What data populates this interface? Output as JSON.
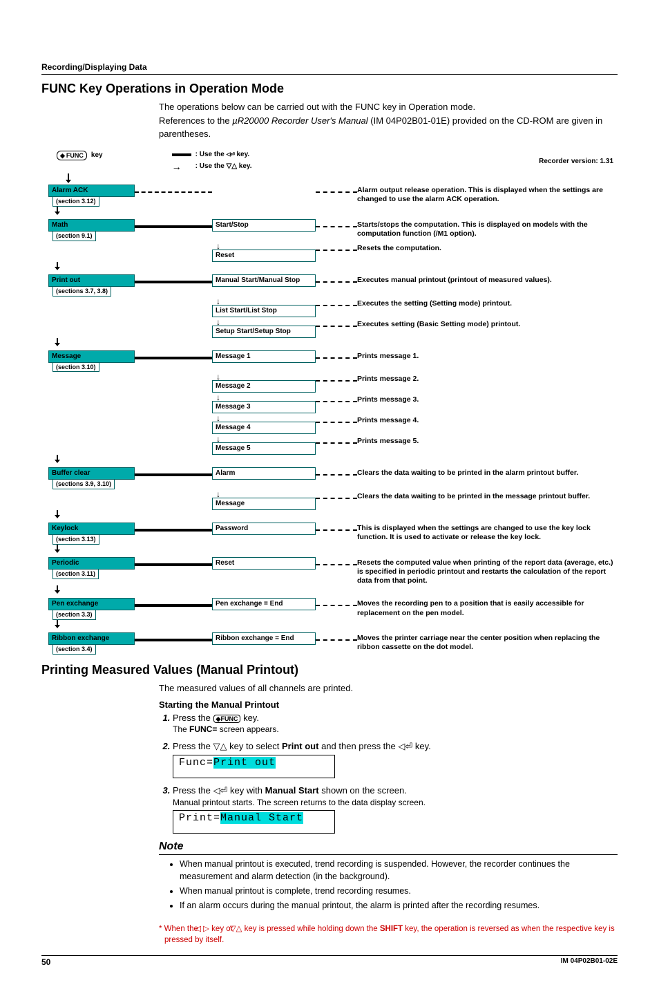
{
  "page": {
    "section_header": "Recording/Displaying Data",
    "h1": "FUNC Key Operations in Operation Mode",
    "intro1": "The operations below can be carried out with the FUNC key in Operation mode.",
    "intro2a": "References to the ",
    "intro2b": "µR20000 Recorder User's Manual",
    "intro2c": " (IM 04P02B01-01E) provided on the CD-ROM are given in parentheses.",
    "func_key": "FUNC",
    "key_label": "key",
    "legend_enter": ": Use the       key.",
    "legend_updown": ": Use the       key.",
    "version": "Recorder version: 1.31",
    "h2": "Printing Measured Values (Manual Printout)",
    "p2": "The measured values of all channels are printed.",
    "h3": "Starting the Manual Printout",
    "step1a": "Press the ",
    "step1b": " key.",
    "step1_sub_a": "The ",
    "step1_sub_b": "FUNC=",
    "step1_sub_c": " screen appears.",
    "step2a": "Press the ",
    "step2b": " key to select ",
    "step2c": "Print out",
    "step2d": " and then press the ",
    "step2e": " key.",
    "screen1_a": "Func=",
    "screen1_b": "Print out",
    "step3a": "Press the ",
    "step3b": " key with ",
    "step3c": "Manual Start",
    "step3d": " shown on the screen.",
    "step3_sub": "Manual printout starts. The screen returns to the data display screen.",
    "screen2_a": "Print=",
    "screen2_b": "Manual Start",
    "note_hdr": "Note",
    "note1": "When manual printout is executed, trend recording is suspended. However, the recorder continues the measurement and alarm detection (in the background).",
    "note2": "When manual printout is complete, trend recording resumes.",
    "note3": "If an alarm occurs during the manual printout, the alarm is printed after the recording resumes.",
    "footnote_a": "*  When the ",
    "footnote_b": " key or ",
    "footnote_c": " key is pressed while holding down the ",
    "footnote_d": "SHIFT",
    "footnote_e": " key, the operation is reversed as when the respective key is pressed by itself.",
    "page_no": "50",
    "doc_id": "IM 04P02B01-02E"
  },
  "diagram": {
    "rows": [
      {
        "lvl1": "Alarm ACK",
        "sec": "(section 3.12)",
        "lvl2": [],
        "desc": "Alarm output release operation.  This is displayed when the settings are changed to use the alarm ACK operation."
      },
      {
        "lvl1": "Math",
        "sec": "(section 9.1)",
        "lvl2": [
          "Start/Stop",
          "Reset"
        ],
        "desc": [
          "Starts/stops the computation.  This is displayed on models with the computation function (/M1 option).",
          "Resets the computation."
        ]
      },
      {
        "lvl1": "Print out",
        "sec": "(sections 3.7, 3.8)",
        "lvl2": [
          "Manual Start/Manual Stop",
          "List Start/List Stop",
          "Setup Start/Setup Stop"
        ],
        "desc": [
          "Executes manual printout (printout of measured values).",
          "Executes the setting (Setting mode) printout.",
          "Executes setting (Basic Setting mode) printout."
        ]
      },
      {
        "lvl1": "Message",
        "sec": "(section 3.10)",
        "lvl2": [
          "Message 1",
          "Message 2",
          "Message 3",
          "Message 4",
          "Message 5"
        ],
        "desc": [
          "Prints message 1.",
          "Prints message 2.",
          "Prints message 3.",
          "Prints message 4.",
          "Prints message 5."
        ]
      },
      {
        "lvl1": "Buffer clear",
        "sec": "(sections 3.9, 3.10)",
        "lvl2": [
          "Alarm",
          "Message"
        ],
        "desc": [
          "Clears the data waiting to be printed in the alarm printout buffer.",
          "Clears the data waiting to be printed in the message printout buffer."
        ]
      },
      {
        "lvl1": "Keylock",
        "sec": "(section 3.13)",
        "lvl2": [
          "Password"
        ],
        "desc": [
          "This is displayed when the settings are changed to use the key lock function.  It is used to activate or release the key lock."
        ]
      },
      {
        "lvl1": "Periodic",
        "sec": "(section 3.11)",
        "lvl2": [
          "Reset"
        ],
        "desc": [
          "Resets the computed value when printing of the report data (average, etc.) is specified in periodic printout and restarts the calculation of the report data from that point."
        ]
      },
      {
        "lvl1": "Pen exchange",
        "sec": "(section 3.3)",
        "lvl2": [
          "Pen exchange = End"
        ],
        "desc": [
          "Moves the recording pen to a position that is easily accessible for replacement on the pen model."
        ]
      },
      {
        "lvl1": "Ribbon exchange",
        "sec": "(section 3.4)",
        "lvl2": [
          "Ribbon exchange = End"
        ],
        "desc": [
          "Moves the printer carriage near the center position when replacing the ribbon cassette on the dot model."
        ]
      }
    ]
  }
}
